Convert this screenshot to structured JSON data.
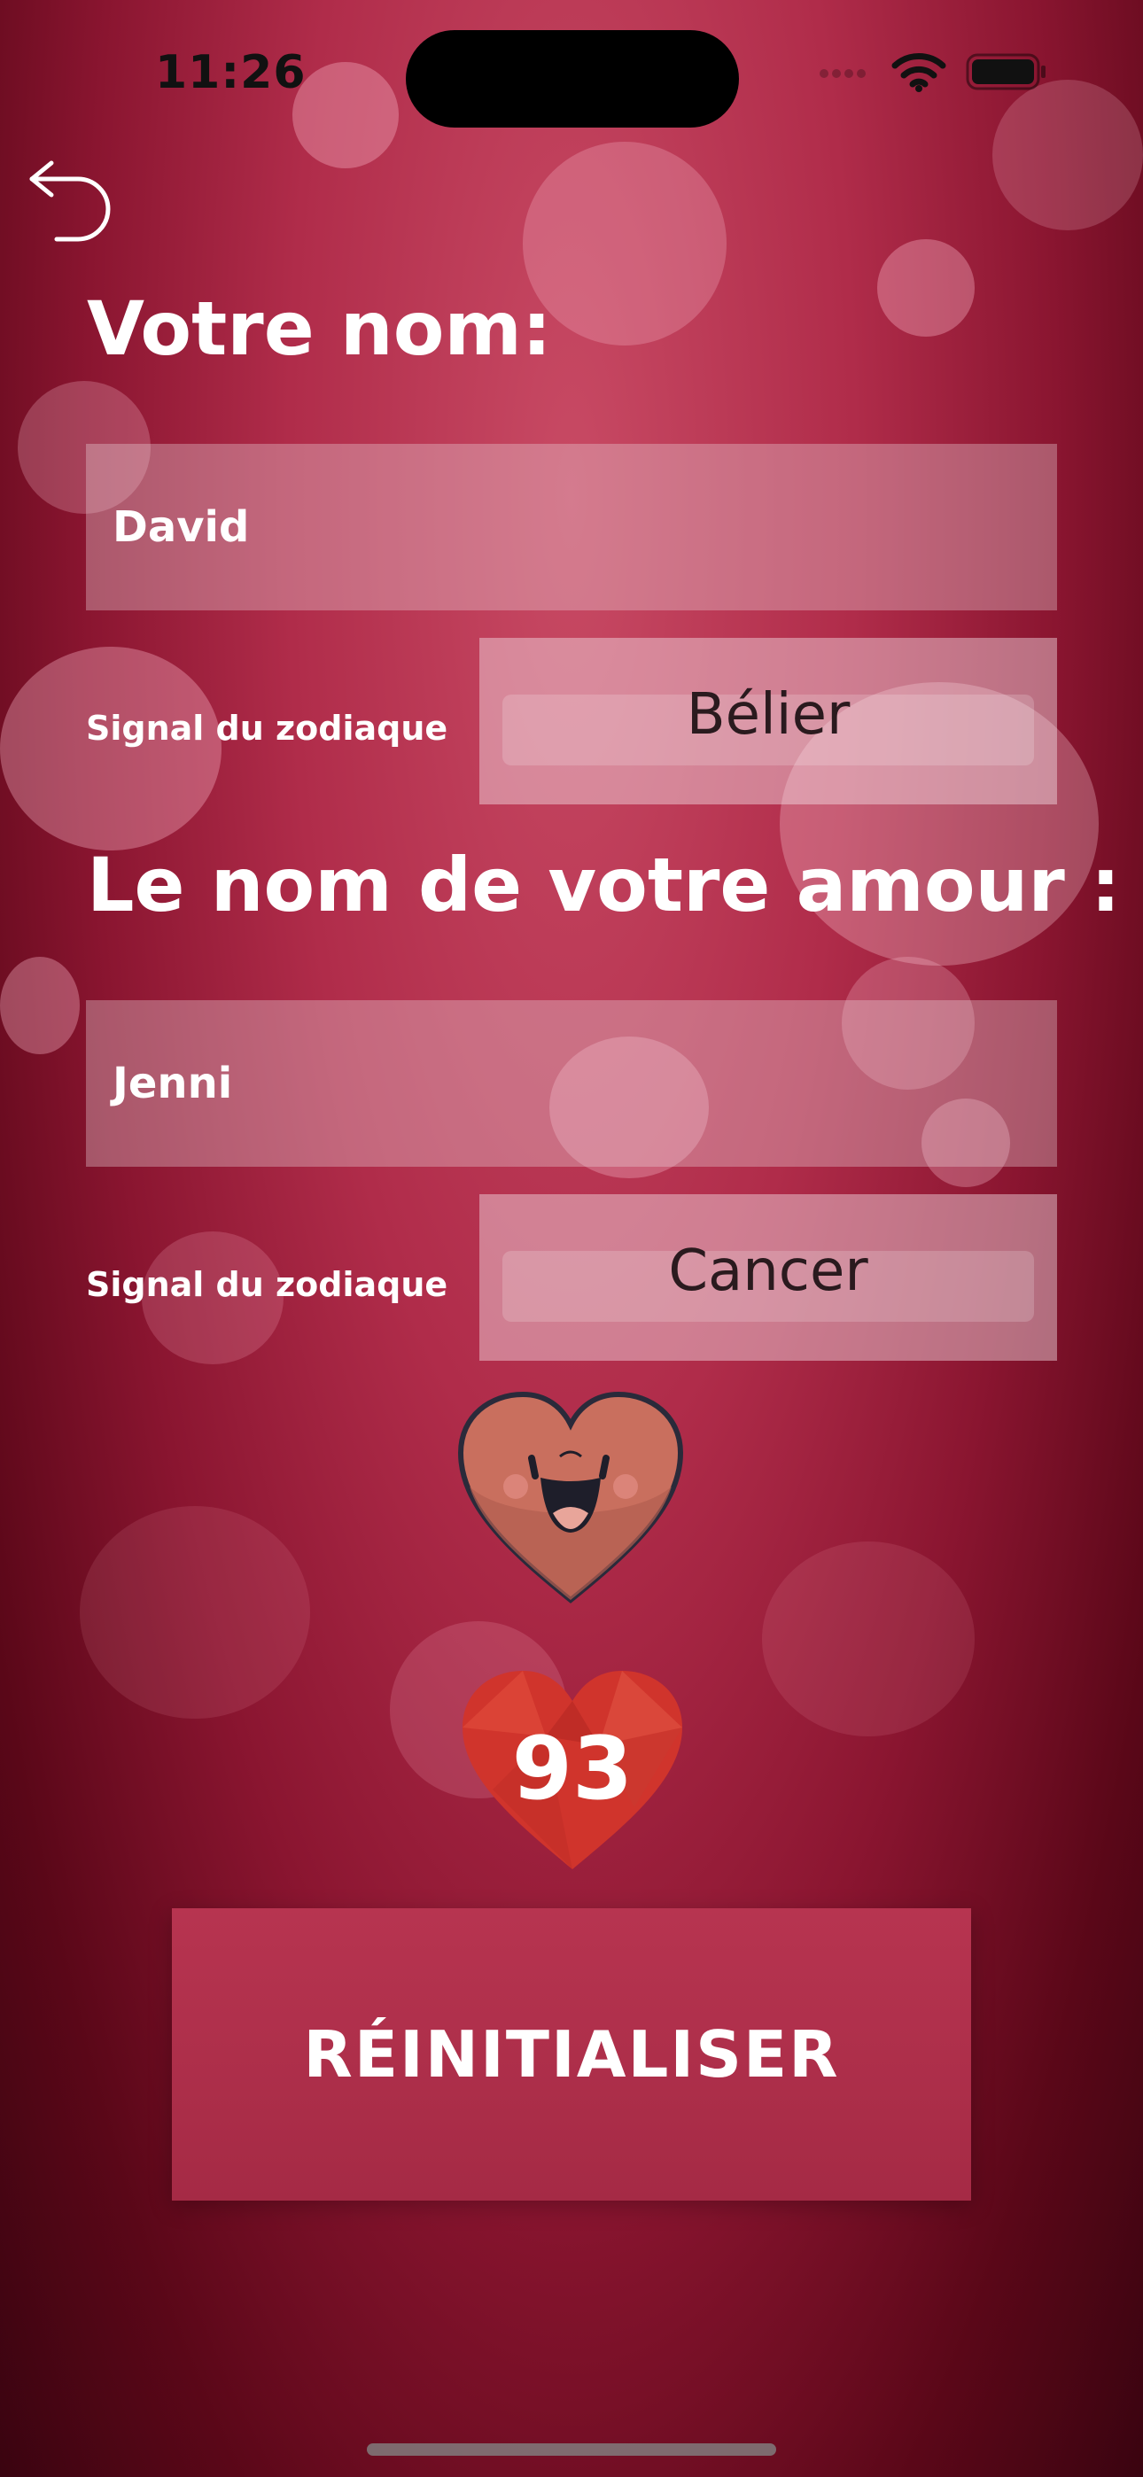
{
  "status_bar": {
    "time": "11:26"
  },
  "icons": {
    "back": "undo-arrow-icon",
    "wifi": "wifi-icon",
    "battery": "battery-icon",
    "mascot": "smiling-heart-icon",
    "score_heart": "polygon-heart-icon"
  },
  "form": {
    "your_name_label": "Votre nom:",
    "your_name_value": "David",
    "zodiac_label_1": "Signal du zodiaque",
    "zodiac_value_1": "Bélier",
    "love_name_label": "Le nom de votre amour :",
    "love_name_value": "Jenni",
    "zodiac_label_2": "Signal du zodiaque",
    "zodiac_value_2": "Cancer"
  },
  "result": {
    "score": "93"
  },
  "actions": {
    "reset_label": "RÉINITIALISER"
  },
  "colors": {
    "background_top": "#c84a64",
    "background_bottom": "#3a0410",
    "button": "#b73450",
    "score_heart": "#d0342c"
  }
}
